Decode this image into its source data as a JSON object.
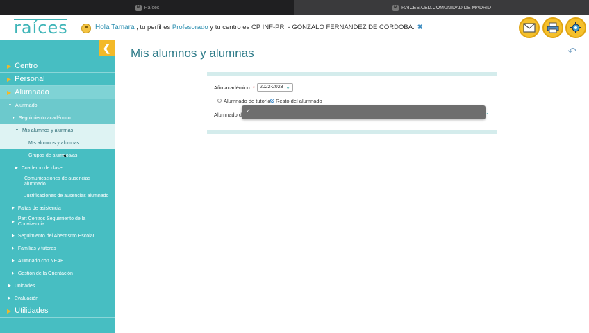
{
  "browser": {
    "tab1": {
      "favicon": "M",
      "title": "Raíces"
    },
    "tab2": {
      "favicon": "M",
      "title": "RAICES.CED.COMUNIDAD DE MADRID"
    }
  },
  "header": {
    "logo": "raíces",
    "greeting": "Hola Tamara",
    "profile_pre": " , tu perfil es ",
    "profile": "Profesorado",
    "center_text": " y tu centro es CP INF-PRI - GONZALO FERNANDEZ DE CORDOBA.",
    "close_symbol": "✖",
    "icons": [
      "mail-icon",
      "print-icon",
      "settings-gear-icon"
    ]
  },
  "sidebar": {
    "collapse_symbol": "❮",
    "items": [
      {
        "label": "Centro"
      },
      {
        "label": "Personal"
      },
      {
        "label": "Alumnado"
      },
      {
        "label": "Alumnado"
      },
      {
        "label": "Seguimiento académico"
      },
      {
        "label": "Mis alumnos y alumnas"
      },
      {
        "label": "Mis alumnos y alumnas"
      },
      {
        "label": "Grupos de alumnos/as"
      },
      {
        "label": "Cuaderno de clase"
      },
      {
        "label": "Comunicaciones de ausencias alumnado"
      },
      {
        "label": "Justificaciones de ausencias alumnado"
      },
      {
        "label": "Faltas de asistencia"
      },
      {
        "label": "Part Centros Seguimiento de la Convivencia"
      },
      {
        "label": "Seguimiento del Abentismo Escolar"
      },
      {
        "label": "Familias y tutores"
      },
      {
        "label": "Alumnado con NEAE"
      },
      {
        "label": "Gestión de la Orientación"
      },
      {
        "label": "Unidades"
      },
      {
        "label": "Evaluación"
      },
      {
        "label": "Utilidades"
      }
    ]
  },
  "main": {
    "title": "Mis alumnos y alumnas",
    "back_symbol": "↶",
    "form": {
      "year_label": "Año académico:",
      "required_mark": "*",
      "year_value": "2022-2023",
      "radio_tutoria": "Alumnado de tutoría",
      "radio_resto": "Resto del alumnado",
      "alumnado_label": "Alumnado de",
      "dropdown_value": "✓"
    }
  }
}
